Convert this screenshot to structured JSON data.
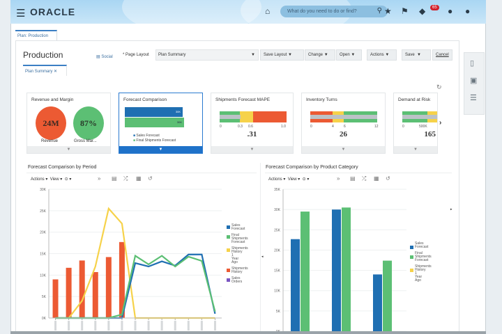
{
  "header": {
    "brand": "ORACLE",
    "search_placeholder": "What do you need to do or find?",
    "notification_count": "65"
  },
  "tabs": [
    {
      "label": "Plan: Production"
    }
  ],
  "page": {
    "title": "Production",
    "social_label": "Social",
    "page_layout_label": "* Page Layout",
    "page_layout_value": "Plan Summary",
    "buttons": {
      "save_layout": "Save Layout",
      "change": "Change",
      "open": "Open",
      "actions": "Actions",
      "save": "Save",
      "cancel": "Cancel"
    },
    "subtab": "Plan Summary"
  },
  "cards": {
    "revenue": {
      "title": "Revenue and Margin",
      "revenue_value": "24M",
      "revenue_label": "Revenue",
      "margin_value": "87%",
      "margin_label": "Gross Mar..."
    },
    "forecast": {
      "title": "Forecast Comparison",
      "bar1": "30K",
      "bar2": "30K",
      "legend1": "Sales Forecast",
      "legend2": "Final Shipments Forecast"
    },
    "mape": {
      "title": "Shipments Forecast MAPE",
      "ticks": [
        "0",
        "0.3",
        "0.6",
        "1.0"
      ],
      "value": ".31"
    },
    "turns": {
      "title": "Inventory Turns",
      "ticks": [
        "0",
        "4",
        "6",
        "12"
      ],
      "value": "26"
    },
    "risk": {
      "title": "Demand at Risk",
      "ticks": [
        "0",
        "500K"
      ],
      "value": "165"
    }
  },
  "colors": {
    "blue": "#1f6fb2",
    "green": "#5cbf74",
    "yellow": "#f6d24a",
    "orange": "#ec5a33",
    "purple": "#7a55c2"
  },
  "chart_data": [
    {
      "type": "bar+line",
      "title": "Forecast Comparison by Period",
      "toolbar": {
        "actions": "Actions",
        "view": "View"
      },
      "ylim": [
        0,
        30000
      ],
      "yticks": [
        "0K",
        "5K",
        "10K",
        "15K",
        "20K",
        "25K",
        "30K"
      ],
      "n_periods": 13,
      "series": [
        {
          "name": "Sales Forecast",
          "kind": "line",
          "color": "#1f6fb2",
          "values": [
            0,
            0,
            0,
            0,
            0,
            0,
            12800,
            12000,
            13200,
            12200,
            14800,
            14800,
            1000
          ]
        },
        {
          "name": "Final Shipments Forecast",
          "kind": "line",
          "color": "#5cbf74",
          "values": [
            0,
            0,
            0,
            0,
            0,
            800,
            14500,
            12500,
            14500,
            12000,
            14300,
            13300,
            1500
          ]
        },
        {
          "name": "Shipments History 1 Year Ago",
          "kind": "line",
          "color": "#f6d24a",
          "values": [
            0,
            0,
            4000,
            12000,
            25500,
            22000,
            0,
            0,
            0,
            0,
            0,
            0,
            0
          ]
        },
        {
          "name": "Shipments History",
          "kind": "bar",
          "color": "#ec5a33",
          "values": [
            9000,
            11700,
            13400,
            10700,
            14200,
            17700,
            null,
            null,
            null,
            null,
            null,
            null,
            null
          ]
        },
        {
          "name": "Sales Orders",
          "kind": "line",
          "color": "#7a55c2",
          "values": []
        }
      ]
    },
    {
      "type": "bar",
      "title": "Forecast Comparison by Product Category",
      "toolbar": {
        "actions": "Actions",
        "view": "View"
      },
      "ylim": [
        0,
        35000
      ],
      "yticks": [
        "0K",
        "5K",
        "10K",
        "15K",
        "20K",
        "25K",
        "30K",
        "35K"
      ],
      "n_categories": 3,
      "series": [
        {
          "name": "Sales Forecast",
          "color": "#1f6fb2",
          "values": [
            22700,
            30000,
            14000
          ]
        },
        {
          "name": "Final Shipments Forecast",
          "color": "#5cbf74",
          "values": [
            29500,
            30500,
            17400
          ]
        },
        {
          "name": "Shipments History 1 Year Ago",
          "color": "#f6d24a",
          "values": [
            0,
            0,
            0
          ]
        }
      ]
    }
  ]
}
